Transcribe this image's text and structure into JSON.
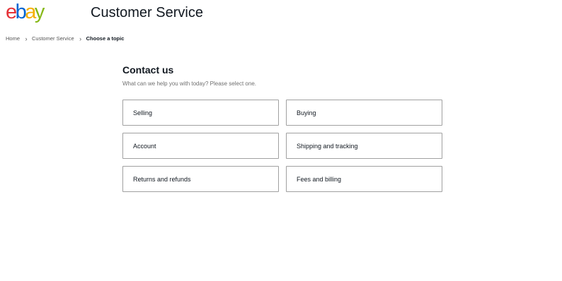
{
  "header": {
    "logo": {
      "letters": [
        {
          "char": "e",
          "color": "#e53238"
        },
        {
          "char": "b",
          "color": "#0064d2"
        },
        {
          "char": "a",
          "color": "#f5af02"
        },
        {
          "char": "y",
          "color": "#86b817"
        }
      ]
    },
    "title": "Customer Service"
  },
  "breadcrumb": {
    "items": [
      "Home",
      "Customer Service",
      "Choose a topic"
    ],
    "separator": "›"
  },
  "main": {
    "heading": "Contact us",
    "subheading": "What can we help you with today? Please select one.",
    "topics": [
      {
        "label": "Selling"
      },
      {
        "label": "Buying"
      },
      {
        "label": "Account"
      },
      {
        "label": "Shipping and tracking"
      },
      {
        "label": "Returns and refunds"
      },
      {
        "label": "Fees and billing"
      }
    ]
  }
}
